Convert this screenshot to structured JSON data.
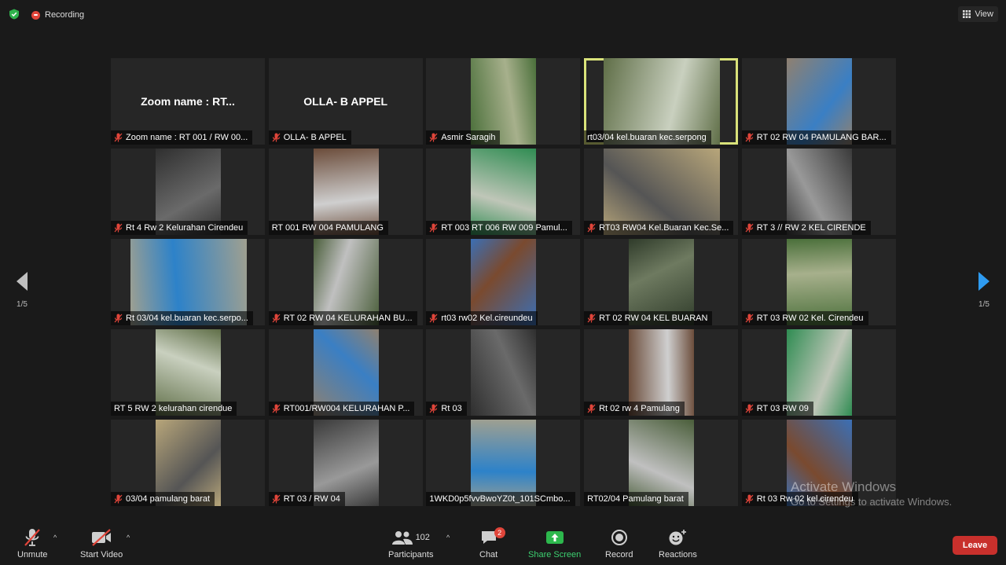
{
  "topbar": {
    "recording_label": "Recording",
    "view_label": "View"
  },
  "nav": {
    "left_page": "1/5",
    "right_page": "1/5"
  },
  "tiles": [
    {
      "label": "Zoom name : RT 001 / RW 00...",
      "big": "Zoom name : RT...",
      "muted": true
    },
    {
      "label": "OLLA- B APPEL",
      "big": "OLLA- B APPEL",
      "muted": true
    },
    {
      "label": "Asmir Saragih",
      "muted": true
    },
    {
      "label": "rt03/04 kel.buaran kec.serpong",
      "muted": false,
      "active": true
    },
    {
      "label": "RT 02 RW 04 PAMULANG BAR...",
      "muted": true
    },
    {
      "label": "Rt 4 Rw 2 Kelurahan Cirendeu",
      "muted": true
    },
    {
      "label": "RT 001 RW 004 PAMULANG",
      "muted": false
    },
    {
      "label": "RT 003 RT 006 RW 009 Pamul...",
      "muted": true
    },
    {
      "label": "RT03 RW04 Kel.Buaran Kec.Se...",
      "muted": true
    },
    {
      "label": "RT 3 // RW 2 KEL CIRENDE",
      "muted": true
    },
    {
      "label": "Rt 03/04 kel.buaran kec.serpo...",
      "muted": true
    },
    {
      "label": "RT 02 RW 04 KELURAHAN BU...",
      "muted": true
    },
    {
      "label": "rt03 rw02 Kel.cireundeu",
      "muted": true
    },
    {
      "label": "RT 02 RW 04 KEL BUARAN",
      "muted": true
    },
    {
      "label": "RT 03 RW 02 Kel. Cirendeu",
      "muted": true
    },
    {
      "label": "RT 5 RW 2 kelurahan cirendue",
      "muted": false
    },
    {
      "label": "RT001/RW004 KELURAHAN P...",
      "muted": true
    },
    {
      "label": "Rt 03",
      "muted": true
    },
    {
      "label": "Rt 02  rw 4 Pamulang",
      "muted": true
    },
    {
      "label": "RT 03 RW 09",
      "muted": true
    },
    {
      "label": "03/04 pamulang barat",
      "muted": true
    },
    {
      "label": "RT 03 / RW 04",
      "muted": true
    },
    {
      "label": "1WKD0p5fvvBwoYZ0t_101SCmbo...",
      "muted": false
    },
    {
      "label": "RT02/04 Pamulang barat",
      "muted": false,
      "underline": true
    },
    {
      "label": "Rt 03 Rw 02 kel.cirendeu",
      "muted": true
    }
  ],
  "watermark": {
    "line1": "Activate Windows",
    "line2": "Go to Settings to activate Windows."
  },
  "toolbar": {
    "unmute": "Unmute",
    "start_video": "Start Video",
    "participants": "Participants",
    "participant_count": "102",
    "chat": "Chat",
    "chat_badge": "2",
    "share_screen": "Share Screen",
    "record": "Record",
    "reactions": "Reactions",
    "leave": "Leave"
  },
  "colors": {
    "share_green": "#3cd070",
    "leave_red": "#c8302c",
    "active_border": "#d9e27a",
    "muted_red": "#e0453a"
  }
}
